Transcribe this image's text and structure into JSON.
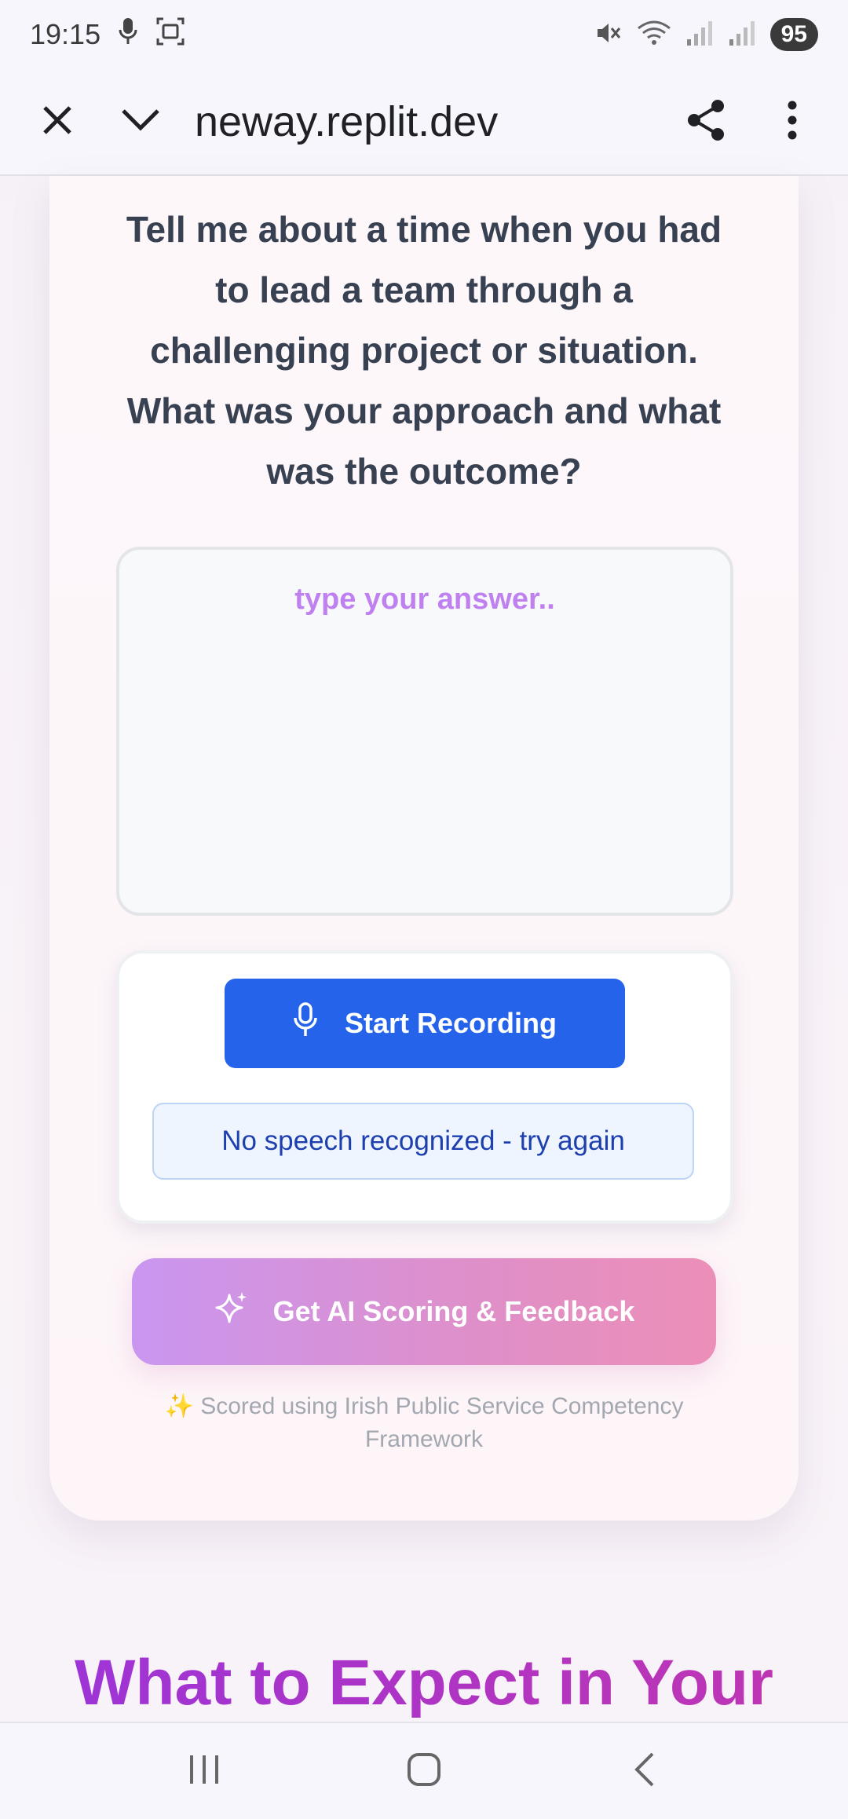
{
  "status_bar": {
    "time": "19:15",
    "battery": "95",
    "icons": [
      "mic-icon",
      "screen-record-icon",
      "mute-icon",
      "wifi-icon",
      "signal-icon",
      "signal-icon"
    ]
  },
  "browser": {
    "url": "neway.replit.dev",
    "close_icon": "close-icon",
    "collapse_icon": "chevron-down-icon",
    "share_icon": "share-icon",
    "menu_icon": "more-vert-icon"
  },
  "question": {
    "text": "Tell me about a time when you had to lead a team through a challenging project or situation. What was your approach and what was the outcome?"
  },
  "answer": {
    "placeholder": "type your answer..",
    "value": ""
  },
  "recording": {
    "button_label": "Start Recording",
    "status_message": "No speech recognized - try again"
  },
  "scoring": {
    "button_label": "Get AI Scoring & Feedback",
    "footnote": "✨ Scored using Irish Public Service Competency Framework"
  },
  "section": {
    "title": "What to Expect in Your"
  },
  "colors": {
    "primary_blue": "#2563eb",
    "accent_purple": "#a431d6",
    "placeholder_purple": "#c081f0"
  }
}
